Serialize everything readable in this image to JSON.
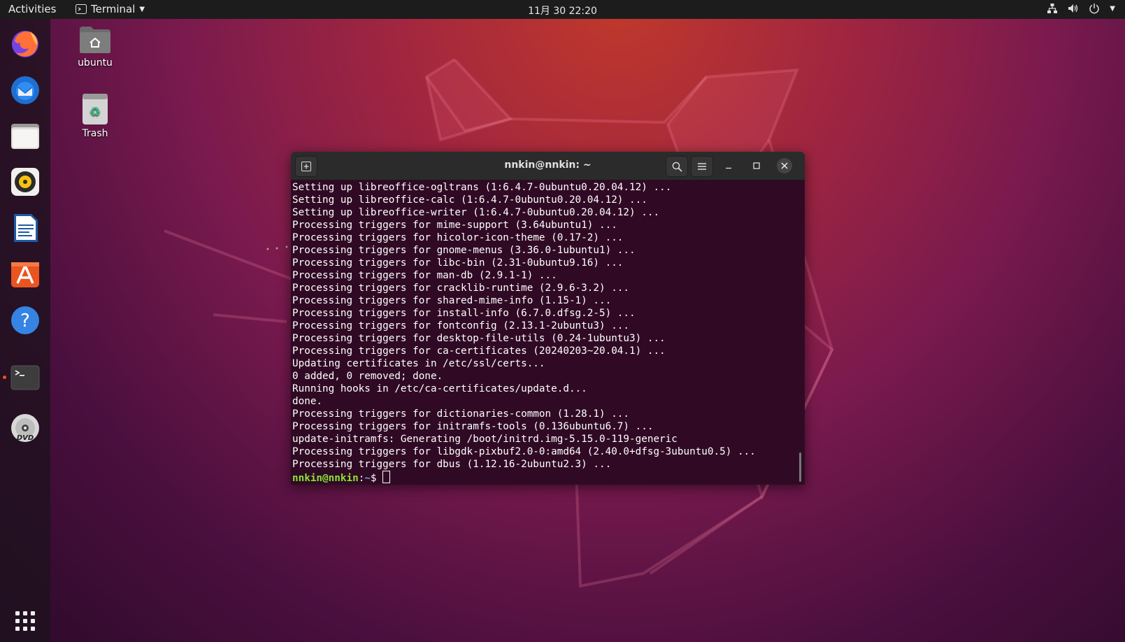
{
  "topbar": {
    "activities": "Activities",
    "app_name": "Terminal",
    "clock": "11月 30  22:20"
  },
  "dock": {
    "items": [
      {
        "name": "Firefox",
        "icon": "firefox-icon"
      },
      {
        "name": "Thunderbird",
        "icon": "thunderbird-icon"
      },
      {
        "name": "Files",
        "icon": "files-icon"
      },
      {
        "name": "Rhythmbox",
        "icon": "rhythmbox-icon"
      },
      {
        "name": "LibreOffice Writer",
        "icon": "writer-icon"
      },
      {
        "name": "Ubuntu Software",
        "icon": "software-icon"
      },
      {
        "name": "Help",
        "icon": "help-icon"
      },
      {
        "name": "Terminal",
        "icon": "terminal-icon",
        "running": true
      },
      {
        "name": "DVD",
        "icon": "dvd-icon",
        "label": "DVD"
      }
    ],
    "show_apps_icon": "grid-icon"
  },
  "desktop": {
    "home_label": "ubuntu",
    "trash_label": "Trash"
  },
  "terminal": {
    "title": "nnkin@nnkin: ~",
    "lines": [
      "Setting up libreoffice-ogltrans (1:6.4.7-0ubuntu0.20.04.12) ...",
      "Setting up libreoffice-calc (1:6.4.7-0ubuntu0.20.04.12) ...",
      "Setting up libreoffice-writer (1:6.4.7-0ubuntu0.20.04.12) ...",
      "Processing triggers for mime-support (3.64ubuntu1) ...",
      "Processing triggers for hicolor-icon-theme (0.17-2) ...",
      "Processing triggers for gnome-menus (3.36.0-1ubuntu1) ...",
      "Processing triggers for libc-bin (2.31-0ubuntu9.16) ...",
      "Processing triggers for man-db (2.9.1-1) ...",
      "Processing triggers for cracklib-runtime (2.9.6-3.2) ...",
      "Processing triggers for shared-mime-info (1.15-1) ...",
      "Processing triggers for install-info (6.7.0.dfsg.2-5) ...",
      "Processing triggers for fontconfig (2.13.1-2ubuntu3) ...",
      "Processing triggers for desktop-file-utils (0.24-1ubuntu3) ...",
      "Processing triggers for ca-certificates (20240203~20.04.1) ...",
      "Updating certificates in /etc/ssl/certs...",
      "0 added, 0 removed; done.",
      "Running hooks in /etc/ca-certificates/update.d...",
      "done.",
      "Processing triggers for dictionaries-common (1.28.1) ...",
      "Processing triggers for initramfs-tools (0.136ubuntu6.7) ...",
      "update-initramfs: Generating /boot/initrd.img-5.15.0-119-generic",
      "Processing triggers for libgdk-pixbuf2.0-0:amd64 (2.40.0+dfsg-3ubuntu0.5) ...",
      "Processing triggers for dbus (1.12.16-2ubuntu2.3) ..."
    ],
    "prompt_user": "nnkin@nnkin",
    "prompt_sep": ":",
    "prompt_path": "~",
    "prompt_symbol": "$ "
  },
  "colors": {
    "accent": "#e95420",
    "terminal_bg": "#300a24",
    "prompt_user": "#8ae234",
    "prompt_path": "#729fcf"
  }
}
